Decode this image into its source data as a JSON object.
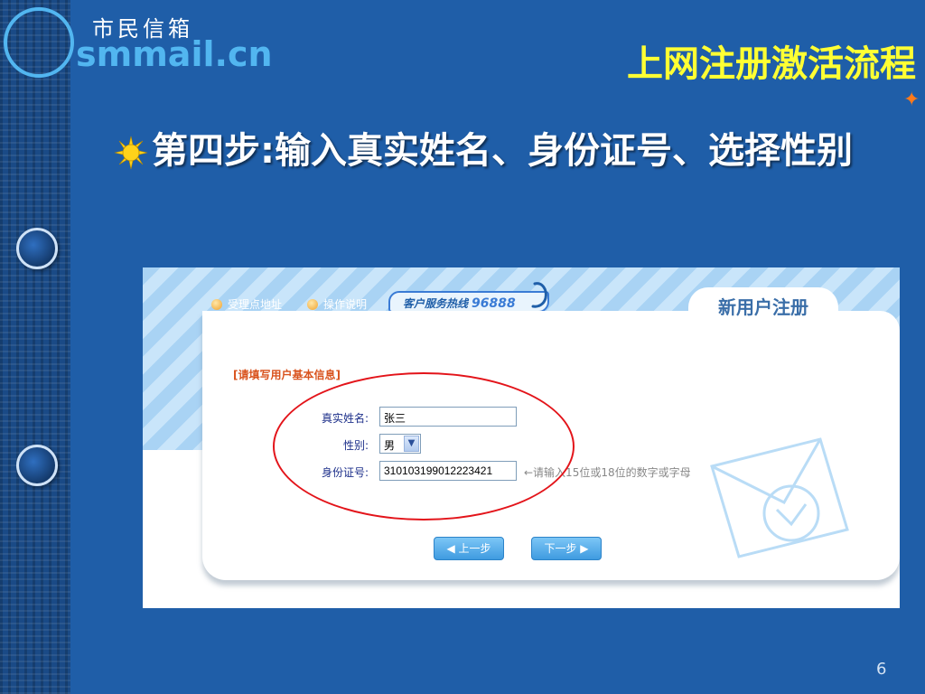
{
  "logo": {
    "cn": "市民信箱",
    "en": "smmail.cn"
  },
  "slide": {
    "title": "上网注册激活流程",
    "heading": "第四步:输入真实姓名、身份证号、选择性别",
    "page_number": "6"
  },
  "screenshot": {
    "links": [
      "受理点地址",
      "操作说明"
    ],
    "hotline_label": "客户服务热线",
    "hotline_number": "96888",
    "tab_title": "新用户注册",
    "section_label": "[请填写用户基本信息]",
    "fields": {
      "name_label": "真实姓名:",
      "name_value": "张三",
      "gender_label": "性别:",
      "gender_value": "男",
      "id_label": "身份证号:",
      "id_value": "310103199012223421",
      "id_hint": "←请输入15位或18位的数字或字母"
    },
    "buttons": {
      "prev": "上一步",
      "next": "下一步"
    }
  },
  "colors": {
    "background": "#1f5ea8",
    "title": "#ffff33",
    "highlight": "#e3141a"
  }
}
